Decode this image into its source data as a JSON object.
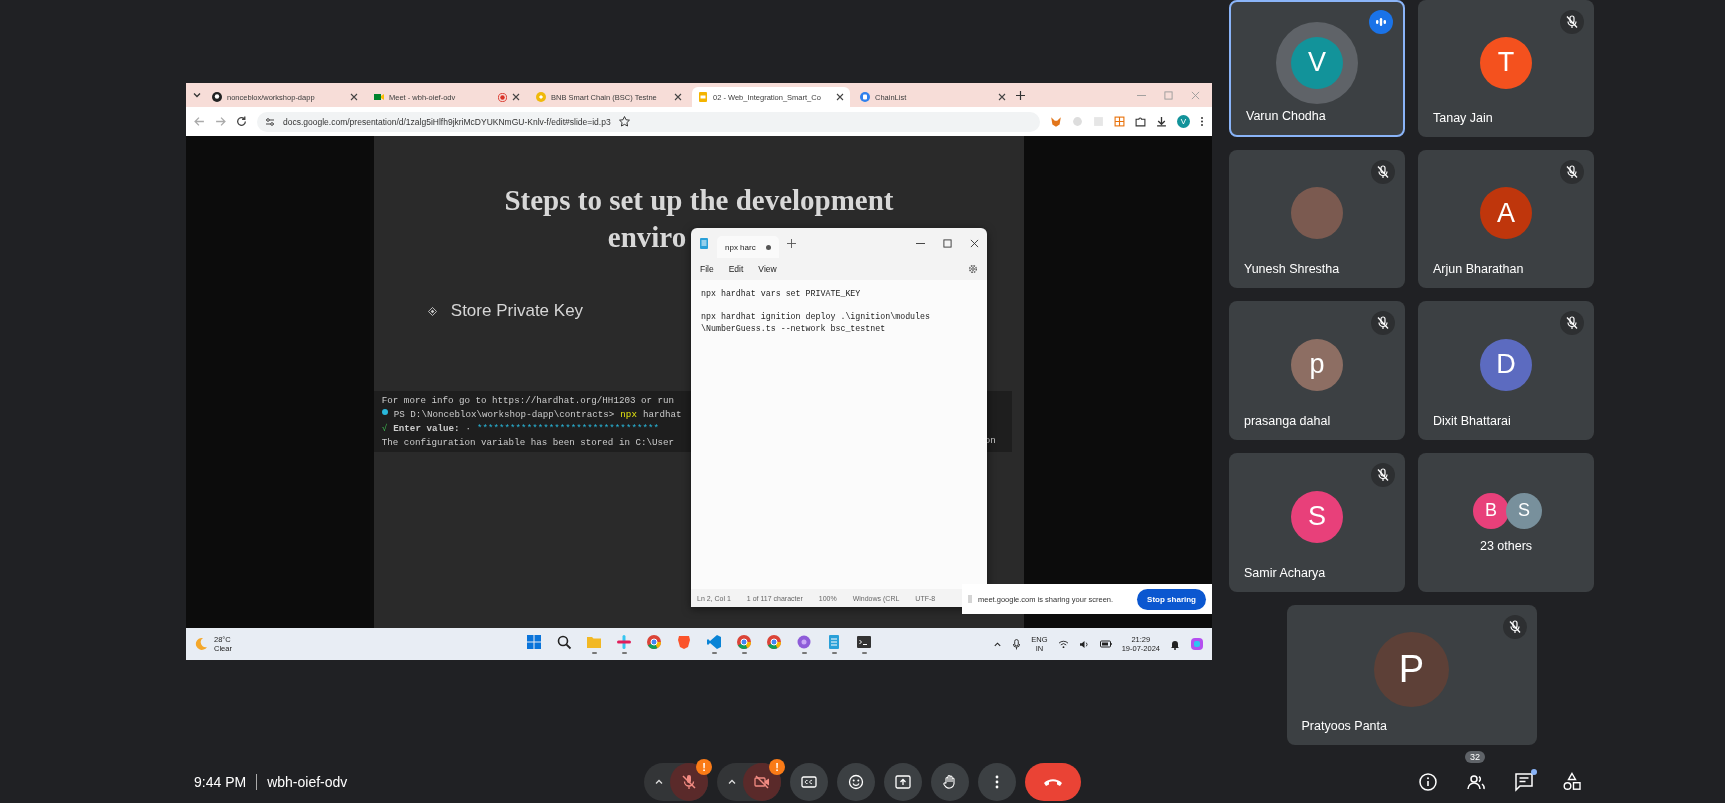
{
  "shared_screen": {
    "browser": {
      "tabs": [
        {
          "title": "nonceblox/workshop-dapp",
          "kind": "github",
          "selected": false,
          "recording": false
        },
        {
          "title": "Meet - wbh-oief-odv",
          "kind": "meet",
          "selected": false,
          "recording": true
        },
        {
          "title": "BNB Smart Chain (BSC) Testne",
          "kind": "bnb",
          "selected": false,
          "recording": false
        },
        {
          "title": "02 - Web_Integration_Smart_Co",
          "kind": "slides",
          "selected": true,
          "recording": false
        },
        {
          "title": "ChainList",
          "kind": "chainlist",
          "selected": false,
          "recording": false
        }
      ],
      "address": "docs.google.com/presentation/d/1zalg5iHlfh9jkriMcDYUKNmGU-Knlv-f/edit#slide=id.p3",
      "profile_initial": "V"
    },
    "slide": {
      "title_line_1": "Steps to set up the development",
      "title_line_2": "enviro",
      "bullets": [
        "Store Private Key"
      ],
      "terminal": [
        {
          "kind": "plain",
          "text": "For more info go to https://hardhat.org/HH1203 or run"
        },
        {
          "kind": "prompt",
          "prompt": "PS D:\\Nonceblox\\workshop-dapp\\contracts>",
          "command": "npx",
          "args": "hardhat"
        },
        {
          "kind": "input",
          "mark": "√",
          "label": "Enter value:",
          "dot": "·",
          "masked": "*********************************"
        },
        {
          "kind": "plain",
          "text": "The configuration variable has been stored in C:\\User"
        }
      ],
      "terminal_tail": "on"
    },
    "notepad": {
      "tab_title": "npx harc",
      "unsaved": true,
      "menu": [
        "File",
        "Edit",
        "View"
      ],
      "paragraphs": [
        [
          "npx hardhat vars set PRIVATE_KEY"
        ],
        [
          "npx hardhat ignition deploy .\\ignition\\modules",
          "\\NumberGuess.ts --network bsc_testnet"
        ]
      ],
      "status": [
        "Ln 2, Col 1",
        "1 of 117 character",
        "100%",
        "Windows (CRL",
        "UTF-8"
      ]
    },
    "share_banner": {
      "message": "meet.google.com is sharing your screen.",
      "button": "Stop sharing"
    },
    "taskbar": {
      "temperature": "28°C",
      "condition": "Clear",
      "apps": [
        {
          "kind": "start",
          "running": false
        },
        {
          "kind": "search",
          "running": false
        },
        {
          "kind": "folder",
          "running": true
        },
        {
          "kind": "slack",
          "running": true
        },
        {
          "kind": "chrome",
          "running": false
        },
        {
          "kind": "brave",
          "running": false
        },
        {
          "kind": "vscode",
          "running": true
        },
        {
          "kind": "chrome",
          "running": true
        },
        {
          "kind": "chrome",
          "running": false
        },
        {
          "kind": "ai",
          "running": true
        },
        {
          "kind": "notepad",
          "running": true
        },
        {
          "kind": "terminal",
          "running": true
        }
      ],
      "language": "ENG",
      "region": "IN",
      "time": "21:29",
      "date": "19-07-2024"
    }
  },
  "participants": [
    {
      "name": "Varun Chodha",
      "initial": "V",
      "color": "#12939a",
      "kind": "initial",
      "muted": false,
      "speaking": true
    },
    {
      "name": "Tanay Jain",
      "initial": "T",
      "color": "#f4511e",
      "kind": "initial",
      "muted": true,
      "speaking": false
    },
    {
      "name": "Yunesh Shrestha",
      "kind": "photo",
      "muted": true,
      "speaking": false
    },
    {
      "name": "Arjun Bharathan",
      "initial": "A",
      "color": "#bf360c",
      "kind": "initial",
      "muted": true,
      "speaking": false
    },
    {
      "name": "prasanga dahal",
      "initial": "p",
      "color": "#8d6e63",
      "kind": "initial",
      "muted": true,
      "speaking": false
    },
    {
      "name": "Dixit Bhattarai",
      "initial": "D",
      "color": "#5c6bc0",
      "kind": "initial",
      "muted": true,
      "speaking": false
    },
    {
      "name": "Samir Acharya",
      "initial": "S",
      "color": "#e8407a",
      "kind": "initial",
      "muted": true,
      "speaking": false
    },
    {
      "kind": "others",
      "label": "23 others",
      "avatars": [
        {
          "initial": "B",
          "color": "#e8407a"
        },
        {
          "initial": "S",
          "color": "#78909c"
        }
      ]
    },
    {
      "name": "Pratyoos Panta",
      "initial": "P",
      "color": "#5d4037",
      "kind": "initial",
      "muted": true,
      "speaking": false
    }
  ],
  "meeting": {
    "time": "9:44 PM",
    "code": "wbh-oief-odv",
    "mic_on": false,
    "mic_warning": "!",
    "camera_on": false,
    "camera_warning": "!",
    "people_count": "32",
    "chat_unread": true
  }
}
